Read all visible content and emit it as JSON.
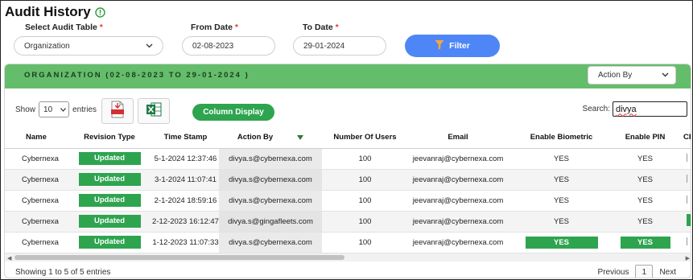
{
  "page": {
    "title": "Audit History"
  },
  "filters": {
    "table_label": "Select Audit Table",
    "table_value": "Organization",
    "from_label": "From Date",
    "from_value": "02-08-2023",
    "to_label": "To Date",
    "to_value": "29-01-2024",
    "required_mark": "*",
    "filter_button": "Filter"
  },
  "card": {
    "title": "ORGANIZATION (02-08-2023 TO 29-01-2024 )",
    "action_by_select": "Action By"
  },
  "controls": {
    "show_label": "Show",
    "entries_value": "10",
    "entries_label": "entries",
    "column_display_button": "Column Display",
    "search_label": "Search:",
    "search_value": "divya"
  },
  "table": {
    "columns": [
      "Name",
      "Revision Type",
      "Time Stamp",
      "Action By",
      "Number Of Users",
      "Email",
      "Enable Biometric",
      "Enable PIN",
      "CR"
    ],
    "rows": [
      {
        "name": "Cybernexa",
        "revision": "Updated",
        "timestamp": "5-1-2024 12:37:46",
        "action_by": "divya.s@cybernexa.com",
        "users": "100",
        "email": "jeevanraj@cybernexa.com",
        "biometric": "YES",
        "pin": "YES",
        "biometric_highlight": false,
        "pin_highlight": false
      },
      {
        "name": "Cybernexa",
        "revision": "Updated",
        "timestamp": "3-1-2024 11:07:41",
        "action_by": "divya.s@cybernexa.com",
        "users": "100",
        "email": "jeevanraj@cybernexa.com",
        "biometric": "YES",
        "pin": "YES",
        "biometric_highlight": false,
        "pin_highlight": false
      },
      {
        "name": "Cybernexa",
        "revision": "Updated",
        "timestamp": "2-1-2024 18:59:16",
        "action_by": "divya.s@cybernexa.com",
        "users": "100",
        "email": "jeevanraj@cybernexa.com",
        "biometric": "YES",
        "pin": "YES",
        "biometric_highlight": false,
        "pin_highlight": false
      },
      {
        "name": "Cybernexa",
        "revision": "Updated",
        "timestamp": "2-12-2023 16:12:47",
        "action_by": "divya.s@gingafleets.com",
        "users": "100",
        "email": "jeevanraj@cybernexa.com",
        "biometric": "YES",
        "pin": "YES",
        "biometric_highlight": false,
        "pin_highlight": false
      },
      {
        "name": "Cybernexa",
        "revision": "Updated",
        "timestamp": "1-12-2023 11:07:33",
        "action_by": "divya.s@cybernexa.com",
        "users": "100",
        "email": "jeevanraj@cybernexa.com",
        "biometric": "YES",
        "pin": "YES",
        "biometric_highlight": true,
        "pin_highlight": true
      }
    ]
  },
  "footer": {
    "info": "Showing 1 to 5 of 5 entries",
    "previous": "Previous",
    "page": "1",
    "next": "Next"
  },
  "colors": {
    "primary_green": "#2ea44f",
    "header_green": "#64bd6b",
    "filter_blue": "#4f86f7",
    "required_red": "#e53935"
  },
  "icons": [
    "info-icon",
    "chevron-down-icon",
    "filter-funnel-icon",
    "pdf-icon",
    "excel-icon",
    "sort-desc-icon"
  ]
}
